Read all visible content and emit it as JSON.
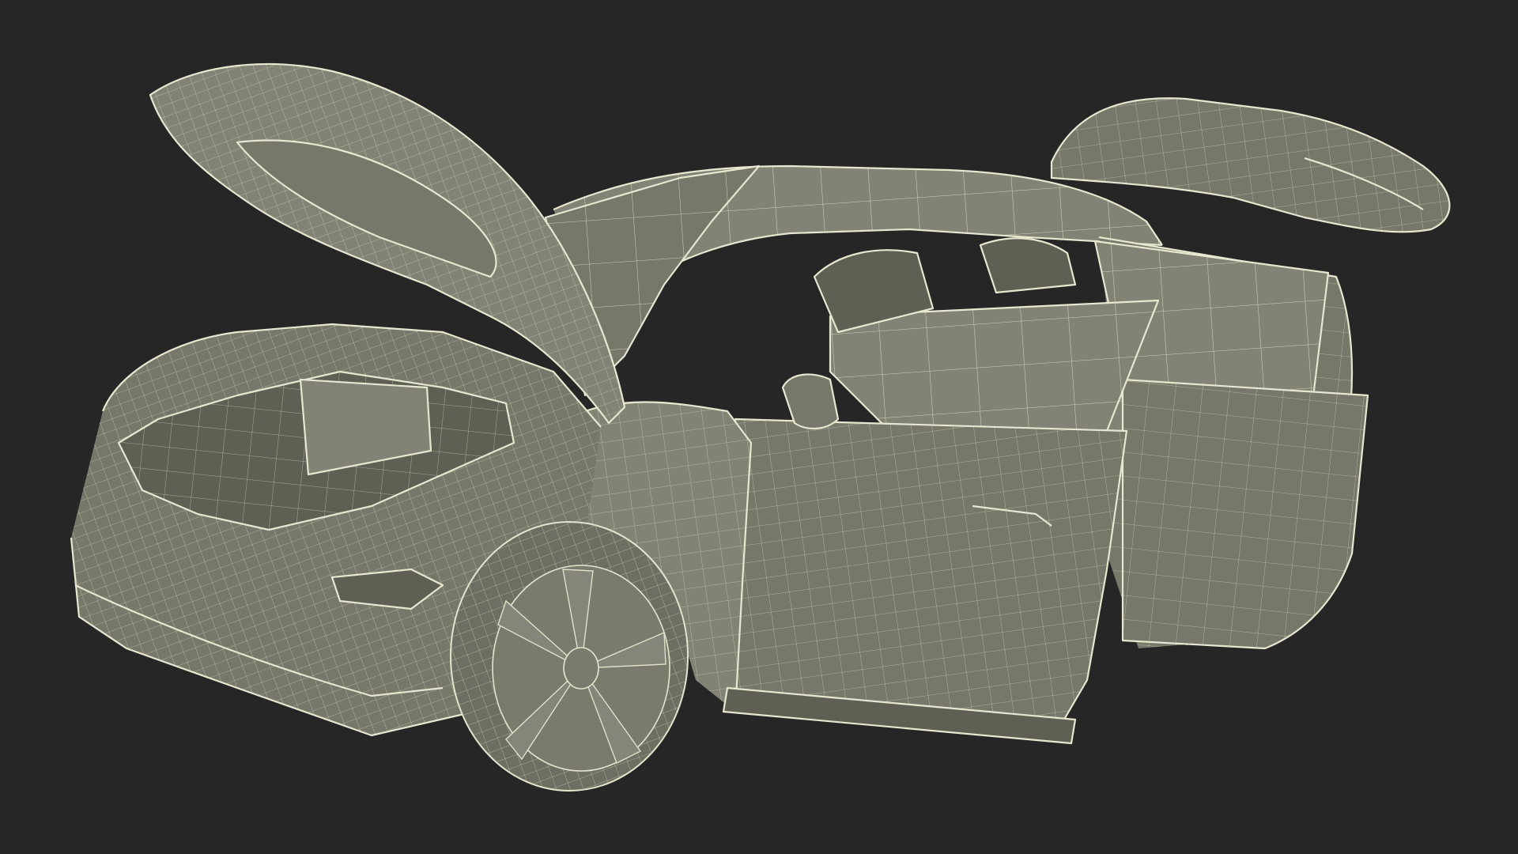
{
  "scene": {
    "subject_icon": "car-wireframe-icon",
    "colors": {
      "background": "#262626",
      "shell": "#77776a",
      "wire": "#e7e6cf"
    }
  }
}
